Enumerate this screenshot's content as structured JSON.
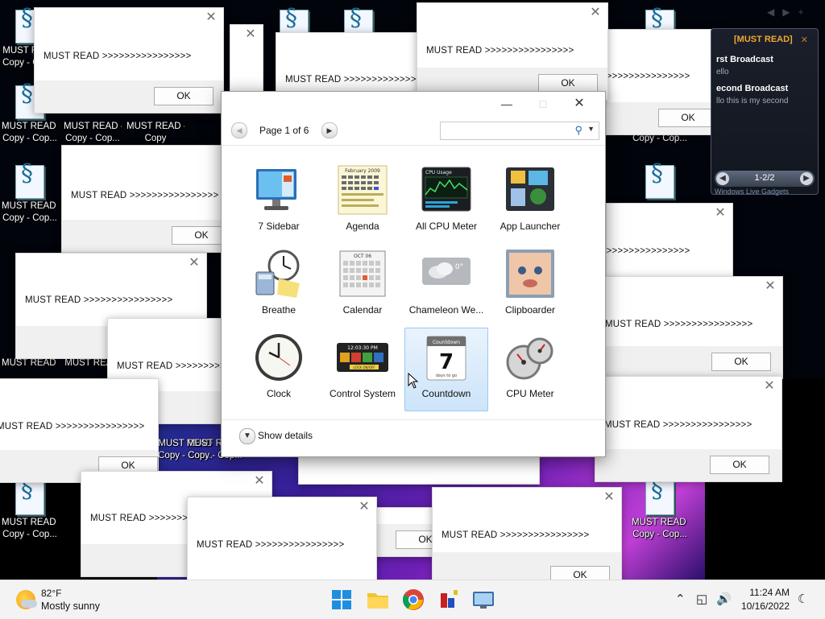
{
  "desktop": {
    "icon_labels": {
      "line1": "MUST READ -",
      "line1_alt": "MUST READ",
      "line2": "Copy - Cop...",
      "line2_alt": "Copy - Copy",
      "copy": "Copy"
    }
  },
  "message_box": {
    "text": "MUST READ >>>>>>>>>>>>>>>>",
    "ok_label": "OK",
    "close_glyph": "✕"
  },
  "feed_gadget": {
    "header": "[MUST READ]",
    "items": [
      {
        "title": "rst Broadcast",
        "body": "ello"
      },
      {
        "title": "econd Broadcast",
        "body": "llo this is my second"
      }
    ],
    "pager_text": "1-2/2",
    "footer": "Windows Live Gadgets"
  },
  "gallery": {
    "page_label": "Page 1 of 6",
    "search_placeholder": "",
    "gadgets": [
      {
        "name": "7 Sidebar",
        "icon": "sidebar-monitor-icon"
      },
      {
        "name": "Agenda",
        "icon": "agenda-calendar-icon"
      },
      {
        "name": "All CPU Meter",
        "icon": "cpu-graph-icon"
      },
      {
        "name": "App Launcher",
        "icon": "app-launcher-icon"
      },
      {
        "name": "Breathe",
        "icon": "clock-calculator-icon"
      },
      {
        "name": "Calendar",
        "icon": "calendar-grid-icon"
      },
      {
        "name": "Chameleon We...",
        "icon": "weather-cloud-icon"
      },
      {
        "name": "Clipboarder",
        "icon": "baby-photo-icon"
      },
      {
        "name": "Clock",
        "icon": "analog-clock-icon"
      },
      {
        "name": "Control System",
        "icon": "control-panel-icon"
      },
      {
        "name": "Countdown",
        "icon": "countdown-calendar-icon"
      },
      {
        "name": "CPU Meter",
        "icon": "gauge-icon"
      }
    ],
    "agenda_month": "February 2009",
    "cpu_title": "CPU Usage",
    "calendar_month": "OCT 06",
    "weather_temp": "0°",
    "countdown": {
      "title": "Countdown",
      "number": "7",
      "subtitle": "days to go"
    },
    "control_time": "12:03:30 PM",
    "control_lock": "LOCK ON/OFF",
    "show_details": "Show details"
  },
  "taskbar": {
    "temperature": "82°F",
    "condition": "Mostly sunny",
    "time": "11:24 AM",
    "date": "10/16/2022"
  },
  "colors": {
    "feed_header": "#f0a830",
    "selection": "#cde4fa",
    "taskbar": "#f3f3f3"
  }
}
